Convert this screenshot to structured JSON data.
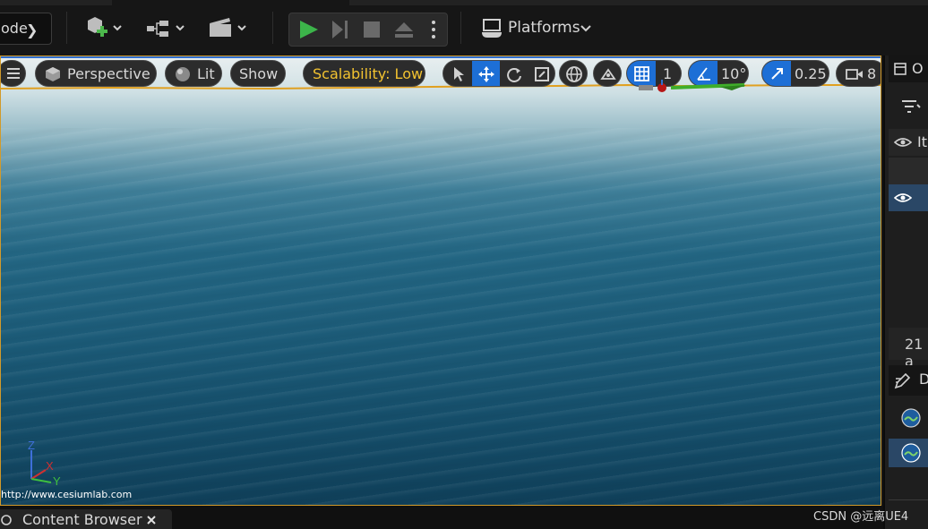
{
  "toolbar": {
    "mode_label": "ode",
    "platforms_label": "Platforms"
  },
  "viewport_toolbar": {
    "view_mode": "Perspective",
    "lighting": "Lit",
    "show": "Show",
    "scalability": "Scalability: Low",
    "grid_snap_value": "1",
    "rotation_snap_value": "10°",
    "scale_snap_value": "0.25",
    "camera_speed_value": "8"
  },
  "viewport": {
    "attribution": "http://www.cesiumlab.com",
    "axis_labels": {
      "z": "Z",
      "x": "X",
      "y": "Y"
    }
  },
  "right_panel": {
    "outliner_title_partial": "O",
    "column_label_partial": "It",
    "count_partial": "21 a",
    "details_title_partial": "D"
  },
  "bottom": {
    "content_browser_tab": "Content Browser",
    "watermark": "CSDN @远离UE4"
  },
  "colors": {
    "accent_blue": "#1d6fd6",
    "selection_border": "#d19a2a",
    "scalability_text": "#f2c230",
    "play_green": "#3cb44a"
  }
}
